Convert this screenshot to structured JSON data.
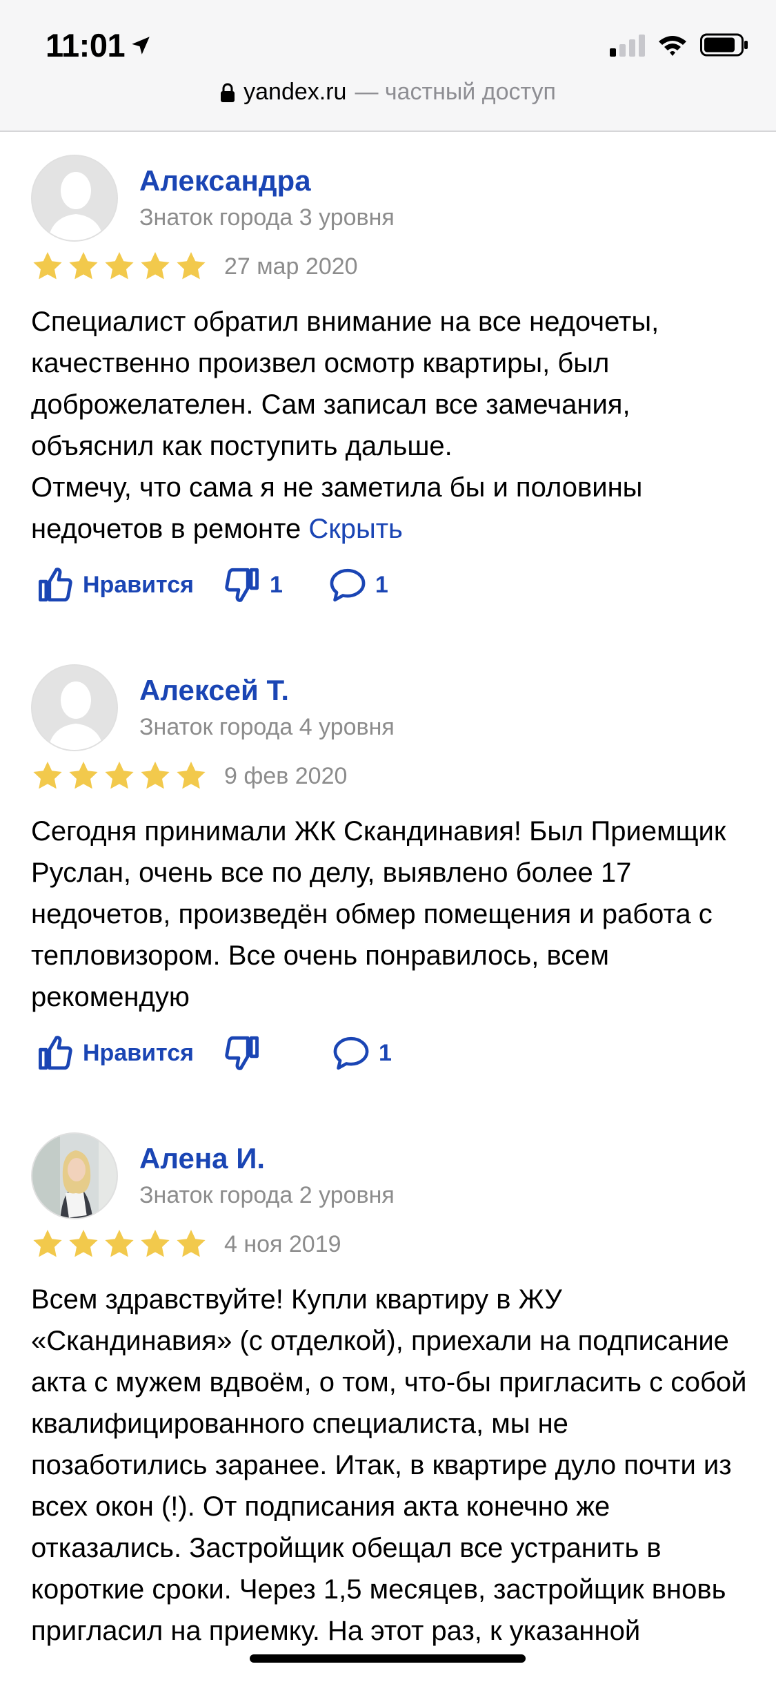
{
  "status_bar": {
    "time": "11:01",
    "signal_bars": 4,
    "signal_active": 1
  },
  "browser": {
    "host": "yandex.ru",
    "note": "— частный доступ"
  },
  "colors": {
    "link": "#1a45b4",
    "meta": "#8c8c8c",
    "star": "#f2c94c"
  },
  "reviews": [
    {
      "name": "Александра",
      "level": "Знаток города 3 уровня",
      "rating": 5,
      "date": "27 мар 2020",
      "paragraphs": [
        "Специалист обратил внимание на все недочеты, качественно произвел осмотр квартиры, был доброжелателен. Сам записал все замечания, объяснил как поступить дальше.",
        "Отмечу, что сама я не заметила бы и половины недочетов в ремонте"
      ],
      "hide_label": "Скрыть",
      "like_label": "Нравится",
      "dislikes": "1",
      "comments": "1"
    },
    {
      "name": "Алексей Т.",
      "level": "Знаток города 4 уровня",
      "rating": 5,
      "date": "9 фев 2020",
      "paragraphs": [
        "Сегодня принимали ЖК Скандинавия! Был Приемщик Руслан, очень все по делу, выявлено более 17 недочетов, произведён обмер помещения и работа с тепловизором. Все очень понравилось, всем рекомендую"
      ],
      "like_label": "Нравится",
      "dislikes": "",
      "comments": "1"
    },
    {
      "name": "Алена И.",
      "level": "Знаток города 2 уровня",
      "rating": 5,
      "date": "4 ноя 2019",
      "paragraphs": [
        "Всем здравствуйте! Купли квартиру в ЖУ «Скандинавия» (с отделкой), приехали на подписание акта с мужем вдвоём, о том, что-бы пригласить с собой квалифицированного специалиста, мы не позаботились заранее. Итак, в квартире дуло почти из всех окон (!). От подписания акта конечно же отказались. Застройщик обещал все устранить в короткие сроки. Через 1,5 месяцев, застройщик вновь пригласил на приемку. На этот раз, к указанной"
      ]
    }
  ]
}
